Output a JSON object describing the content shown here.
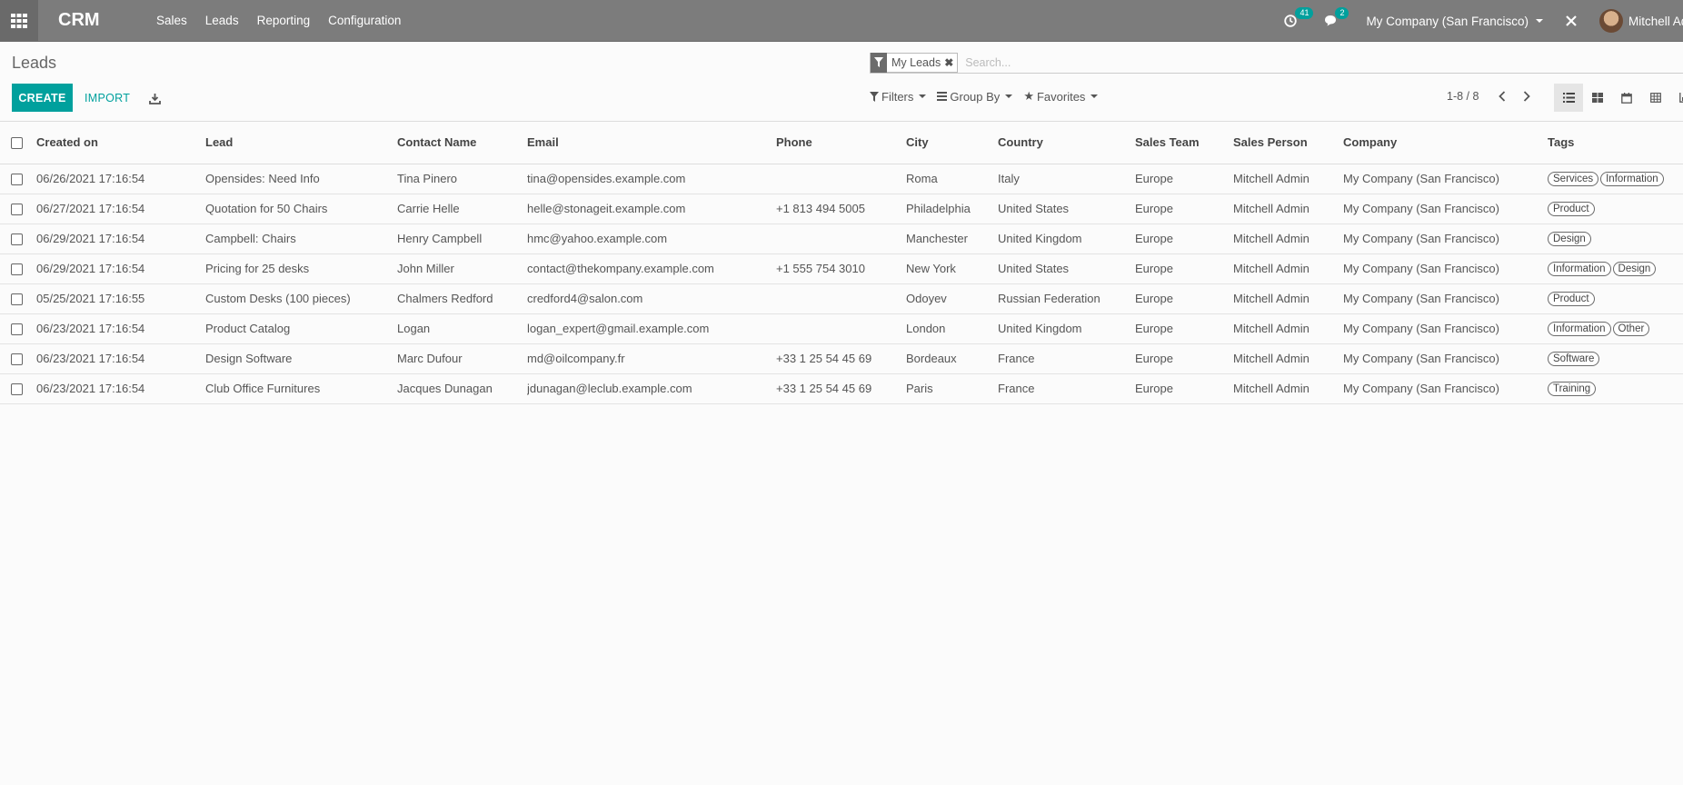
{
  "navbar": {
    "brand": "CRM",
    "menu": [
      "Sales",
      "Leads",
      "Reporting",
      "Configuration"
    ],
    "activity_count": "41",
    "message_count": "2",
    "company": "My Company (San Francisco)",
    "user": "Mitchell Admin"
  },
  "control": {
    "breadcrumb": "Leads",
    "create_label": "CREATE",
    "import_label": "IMPORT",
    "facet_label": "My Leads",
    "search_placeholder": "Search...",
    "filters_label": "Filters",
    "groupby_label": "Group By",
    "favorites_label": "Favorites",
    "pager": "1-8 / 8"
  },
  "table": {
    "columns": [
      "Created on",
      "Lead",
      "Contact Name",
      "Email",
      "Phone",
      "City",
      "Country",
      "Sales Team",
      "Sales Person",
      "Company",
      "Tags"
    ],
    "rows": [
      {
        "created": "06/26/2021 17:16:54",
        "lead": "Opensides: Need Info",
        "contact": "Tina Pinero",
        "email": "tina@opensides.example.com",
        "phone": "",
        "city": "Roma",
        "country": "Italy",
        "team": "Europe",
        "person": "Mitchell Admin",
        "company": "My Company (San Francisco)",
        "tags": [
          "Services",
          "Information"
        ]
      },
      {
        "created": "06/27/2021 17:16:54",
        "lead": "Quotation for 50 Chairs",
        "contact": "Carrie Helle",
        "email": "helle@stonageit.example.com",
        "phone": "+1 813 494 5005",
        "city": "Philadelphia",
        "country": "United States",
        "team": "Europe",
        "person": "Mitchell Admin",
        "company": "My Company (San Francisco)",
        "tags": [
          "Product"
        ]
      },
      {
        "created": "06/29/2021 17:16:54",
        "lead": "Campbell: Chairs",
        "contact": "Henry Campbell",
        "email": "hmc@yahoo.example.com",
        "phone": "",
        "city": "Manchester",
        "country": "United Kingdom",
        "team": "Europe",
        "person": "Mitchell Admin",
        "company": "My Company (San Francisco)",
        "tags": [
          "Design"
        ]
      },
      {
        "created": "06/29/2021 17:16:54",
        "lead": "Pricing for 25 desks",
        "contact": "John Miller",
        "email": "contact@thekompany.example.com",
        "phone": "+1 555 754 3010",
        "city": "New York",
        "country": "United States",
        "team": "Europe",
        "person": "Mitchell Admin",
        "company": "My Company (San Francisco)",
        "tags": [
          "Information",
          "Design"
        ]
      },
      {
        "created": "05/25/2021 17:16:55",
        "lead": "Custom Desks (100 pieces)",
        "contact": "Chalmers Redford",
        "email": "credford4@salon.com",
        "phone": "",
        "city": "Odoyev",
        "country": "Russian Federation",
        "team": "Europe",
        "person": "Mitchell Admin",
        "company": "My Company (San Francisco)",
        "tags": [
          "Product"
        ]
      },
      {
        "created": "06/23/2021 17:16:54",
        "lead": "Product Catalog",
        "contact": "Logan",
        "email": "logan_expert@gmail.example.com",
        "phone": "",
        "city": "London",
        "country": "United Kingdom",
        "team": "Europe",
        "person": "Mitchell Admin",
        "company": "My Company (San Francisco)",
        "tags": [
          "Information",
          "Other"
        ]
      },
      {
        "created": "06/23/2021 17:16:54",
        "lead": "Design Software",
        "contact": "Marc Dufour",
        "email": "md@oilcompany.fr",
        "phone": "+33 1 25 54 45 69",
        "city": "Bordeaux",
        "country": "France",
        "team": "Europe",
        "person": "Mitchell Admin",
        "company": "My Company (San Francisco)",
        "tags": [
          "Software"
        ]
      },
      {
        "created": "06/23/2021 17:16:54",
        "lead": "Club Office Furnitures",
        "contact": "Jacques Dunagan",
        "email": "jdunagan@leclub.example.com",
        "phone": "+33 1 25 54 45 69",
        "city": "Paris",
        "country": "France",
        "team": "Europe",
        "person": "Mitchell Admin",
        "company": "My Company (San Francisco)",
        "tags": [
          "Training"
        ]
      }
    ]
  }
}
